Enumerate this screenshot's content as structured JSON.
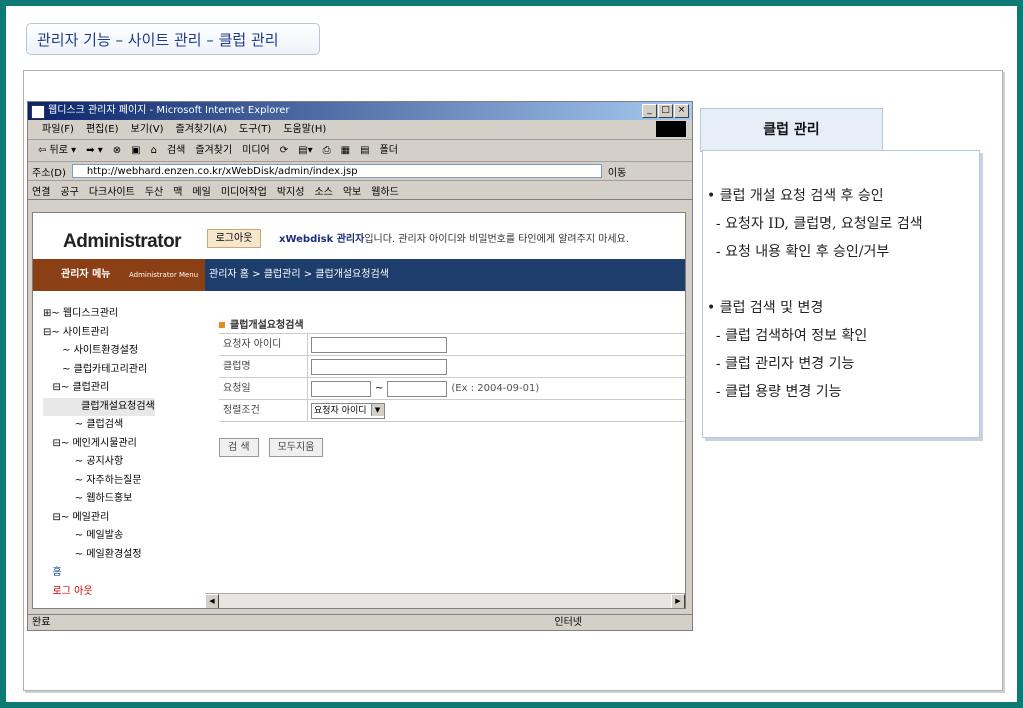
{
  "page_title": "관리자 기능 – 사이트 관리 – 클럽 관리",
  "ie": {
    "window_title": "웹디스크 관리자 페이지 - Microsoft Internet Explorer",
    "menu": [
      "파일(F)",
      "편집(E)",
      "보기(V)",
      "즐겨찾기(A)",
      "도구(T)",
      "도움말(H)"
    ],
    "toolbar": [
      "⇦ 뒤로 ▾",
      "➡ ▾",
      "⊗",
      "▣",
      "⌂",
      "검색",
      "즐겨찾기",
      "미디어",
      "⟳",
      "▤▾",
      "⎙",
      "▦",
      "▤",
      "폴더"
    ],
    "address_label": "주소(D)",
    "address": "http://webhard.enzen.co.kr/xWebDisk/admin/index.jsp",
    "go_label": "이동",
    "links_label": "연결",
    "links": [
      "공구",
      "다크사이트",
      "두산",
      "맥",
      "메일",
      "미디어작업",
      "박지성",
      "소스",
      "악보",
      "웹하드"
    ],
    "status": "완료",
    "zone": "인터넷"
  },
  "admin": {
    "logo": "Administrator",
    "menu_title": "관리자 메뉴",
    "menu_sub": "Administrator Menu",
    "logout": "로그아웃",
    "notice_bold": "xWebdisk 관리자",
    "notice_rest": "입니다. 관리자 아이디와 비밀번호를 타인에게 알려주지 마세요.",
    "breadcrumb": "관리자 홈 > 클럽관리 > 클럽개설요청검색",
    "tree": [
      "⊞~ 웹디스크관리",
      "⊟~ 사이트관리",
      "      ~ 사이트환경설정",
      "      ~ 클럽카테고리관리",
      "   ⊟~ 클럽관리",
      "            클럽개설요청검색",
      "          ~ 클럽검색",
      "   ⊟~ 메인게시물관리",
      "          ~ 공지사항",
      "          ~ 자주하는질문",
      "          ~ 웹하드홍보",
      "   ⊟~ 메일관리",
      "          ~ 메일발송",
      "          ~ 메일환경설정",
      "   홈",
      "   로그 아웃"
    ],
    "section_title": "클럽개설요청검색",
    "form": {
      "requester_id": "요청자 아이디",
      "club_name": "클럽명",
      "request_date": "요청일",
      "date_sep": "~",
      "date_hint": "(Ex : 2004-09-01)",
      "sort_label": "정렬조건",
      "sort_value": "요청자 아이디"
    },
    "search_btn": "검 색",
    "clear_btn": "모두지움"
  },
  "panel": {
    "title": "클럽 관리",
    "lines": [
      "• 클럽 개설 요청 검색 후 승인",
      "  - 요청자 ID, 클럽명, 요청일로 검색",
      "  - 요청 내용 확인 후 승인/거부",
      "• 클럽 검색 및 변경",
      "  - 클럽 검색하여 정보 확인",
      "  - 클럽 관리자 변경 기능",
      "  - 클럽 용량 변경 기능"
    ]
  }
}
